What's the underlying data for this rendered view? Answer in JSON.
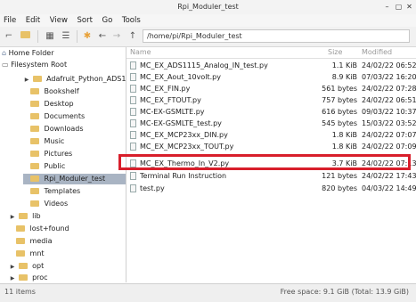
{
  "window": {
    "title": "Rpi_Moduler_test"
  },
  "menu": [
    "File",
    "Edit",
    "View",
    "Sort",
    "Go",
    "Tools"
  ],
  "toolbar": {
    "path": "/home/pi/Rpi_Moduler_test"
  },
  "sidebar": {
    "items": [
      {
        "label": "Home Folder",
        "icon": "home-icon"
      },
      {
        "label": "Filesystem Root",
        "icon": "drive-icon"
      },
      {
        "label": "Adafruit_Python_ADS1x15",
        "arrow": "▶"
      },
      {
        "label": "Bookshelf"
      },
      {
        "label": "Desktop"
      },
      {
        "label": "Documents"
      },
      {
        "label": "Downloads"
      },
      {
        "label": "Music"
      },
      {
        "label": "Pictures"
      },
      {
        "label": "Public"
      },
      {
        "label": "Rpi_Moduler_test",
        "selected": true
      },
      {
        "label": "Templates"
      },
      {
        "label": "Videos"
      },
      {
        "label": "lib",
        "arrow": "▶"
      },
      {
        "label": "lost+found"
      },
      {
        "label": "media"
      },
      {
        "label": "mnt"
      },
      {
        "label": "opt",
        "arrow": "▶"
      },
      {
        "label": "proc",
        "arrow": "▶"
      }
    ]
  },
  "files": {
    "headers": {
      "name": "Name",
      "size": "Size",
      "modified": "Modified"
    },
    "rows": [
      {
        "name": "MC_EX_ADS1115_Analog_IN_test.py",
        "size": "1.1 KiB",
        "modified": "24/02/22 06:52"
      },
      {
        "name": "MC_EX_Aout_10volt.py",
        "size": "8.9 KiB",
        "modified": "07/03/22 16:20"
      },
      {
        "name": "MC_EX_FIN.py",
        "size": "561 bytes",
        "modified": "24/02/22 07:28"
      },
      {
        "name": "MC_EX_FTOUT.py",
        "size": "757 bytes",
        "modified": "24/02/22 06:51"
      },
      {
        "name": "MC-EX-GSMLTE.py",
        "size": "616 bytes",
        "modified": "09/03/22 10:37"
      },
      {
        "name": "MC-EX-GSMLTE_test.py",
        "size": "545 bytes",
        "modified": "15/03/22 03:52"
      },
      {
        "name": "MC_EX_MCP23xx_DIN.py",
        "size": "1.8 KiB",
        "modified": "24/02/22 07:07"
      },
      {
        "name": "MC_EX_MCP23xx_TOUT.py",
        "size": "1.8 KiB",
        "modified": "24/02/22 07:09"
      },
      {
        "name": "MC_EX_Thermo_In_V2.py",
        "size": "3.7 KiB",
        "modified": "24/02/22 07:13"
      },
      {
        "name": "Terminal Run Instruction",
        "size": "121 bytes",
        "modified": "24/02/22 17:43"
      },
      {
        "name": "test.py",
        "size": "820 bytes",
        "modified": "04/03/22 14:49"
      }
    ]
  },
  "status": {
    "left": "11 items",
    "right": "Free space: 9.1 GiB (Total: 13.9 GiB)"
  },
  "colors": {
    "highlight": "#d81e2b",
    "selection": "#a9b4c3",
    "folder": "#e8c268"
  }
}
